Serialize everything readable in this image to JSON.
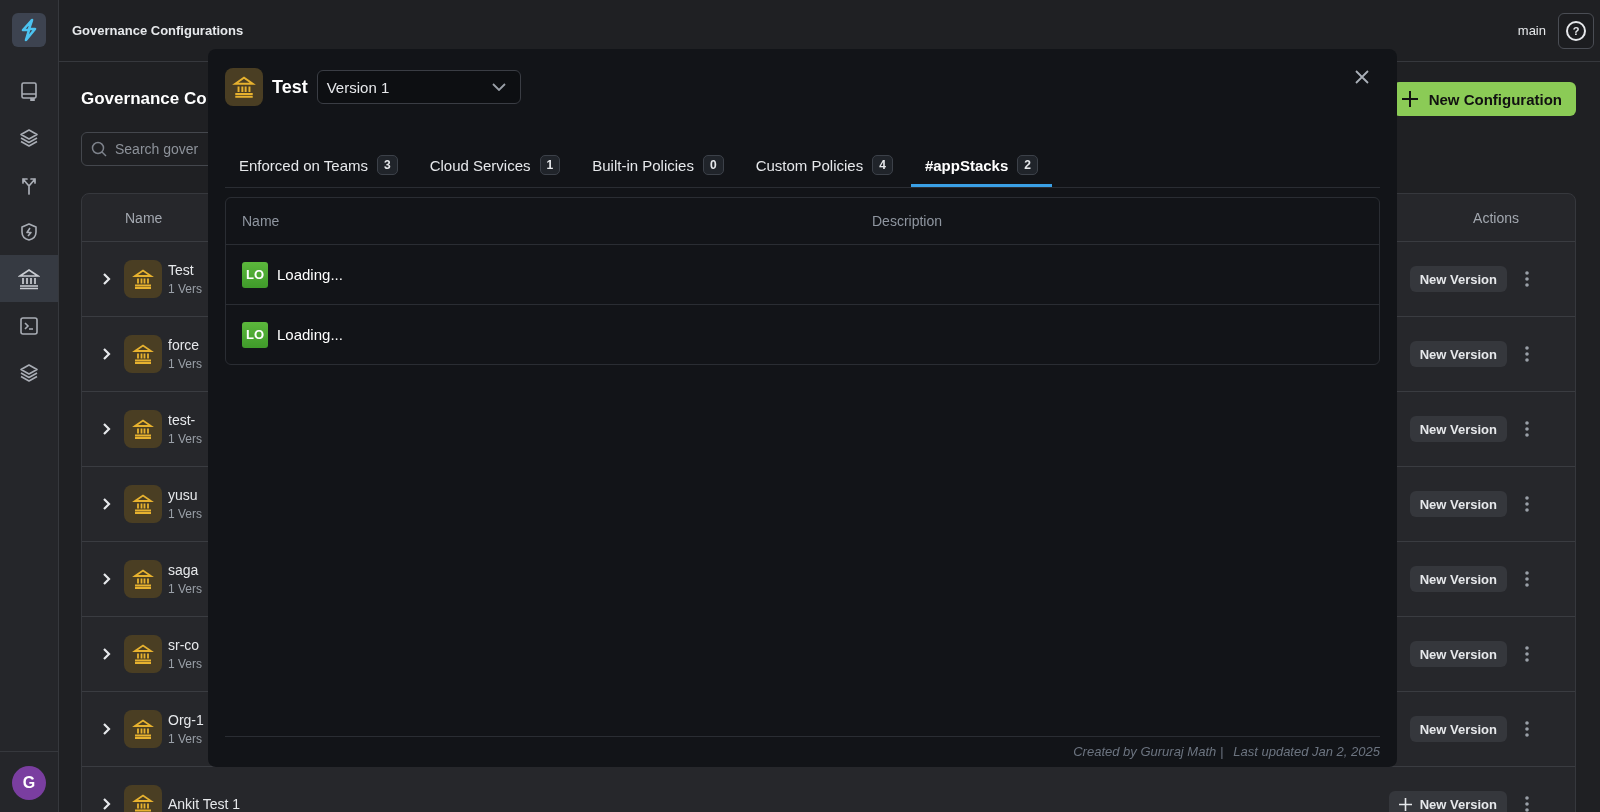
{
  "top_bar": {
    "title": "Governance Configurations",
    "branch": "main",
    "help": "?"
  },
  "sidebar": {
    "items": [
      {
        "kind": "book",
        "selected": false
      },
      {
        "kind": "layers",
        "selected": false
      },
      {
        "kind": "fork",
        "selected": false
      },
      {
        "kind": "shield",
        "selected": false
      },
      {
        "kind": "bank",
        "selected": true
      },
      {
        "kind": "terminal",
        "selected": false
      },
      {
        "kind": "layers",
        "selected": false
      }
    ],
    "avatar": "G"
  },
  "page": {
    "heading": "Governance Co",
    "search": {
      "placeholder": "Search gover"
    },
    "new_button": "New Configuration",
    "table": {
      "columns": [
        "Name",
        "Actions"
      ],
      "rows": [
        {
          "name": "Test",
          "versions": "1 Vers",
          "action": "New Version"
        },
        {
          "name": "force",
          "versions": "1 Vers",
          "action": "New Version"
        },
        {
          "name": "test-",
          "versions": "1 Vers",
          "action": "New Version"
        },
        {
          "name": "yusu",
          "versions": "1 Vers",
          "action": "New Version"
        },
        {
          "name": "saga",
          "versions": "1 Vers",
          "action": "New Version"
        },
        {
          "name": "sr-co",
          "versions": "1 Vers",
          "action": "New Version"
        },
        {
          "name": "Org-1",
          "versions": "1 Vers",
          "action": "New Version"
        },
        {
          "name": "Ankit Test 1",
          "action": "New Version"
        }
      ]
    }
  },
  "modal": {
    "title": "Test",
    "version": "Version 1",
    "tabs": [
      {
        "label": "Enforced on Teams",
        "count": "3",
        "selected": false
      },
      {
        "label": "Cloud Services",
        "count": "1",
        "selected": false
      },
      {
        "label": "Built-in Policies",
        "count": "0",
        "selected": false
      },
      {
        "label": "Custom Policies",
        "count": "4",
        "selected": false
      },
      {
        "label": "#appStacks",
        "count": "2",
        "selected": true
      }
    ],
    "table": {
      "columns": [
        "Name",
        "Description"
      ],
      "rows": [
        {
          "badge": "LO",
          "name": "Loading..."
        },
        {
          "badge": "LO",
          "name": "Loading..."
        }
      ]
    },
    "footer": {
      "created": "Created by Gururaj Math |",
      "updated": "Last updated Jan 2, 2025"
    }
  }
}
